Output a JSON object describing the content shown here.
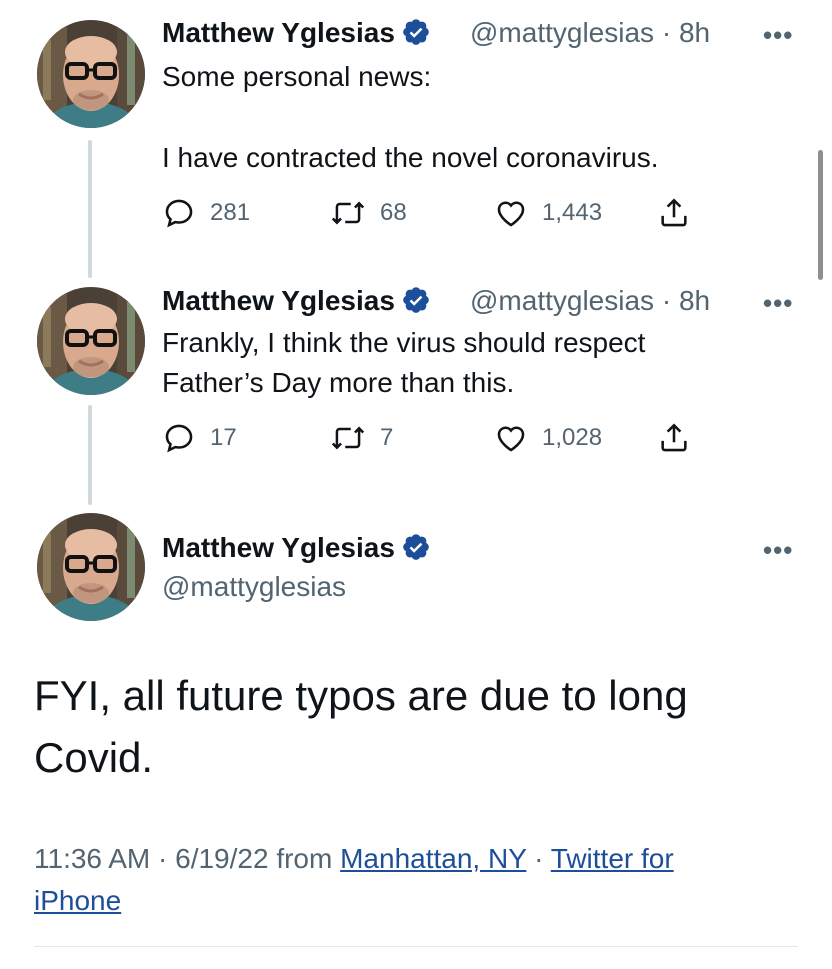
{
  "colors": {
    "verified": "#1d9bf0",
    "link": "#1d4e9a",
    "secondary_text": "#536471"
  },
  "tweets": [
    {
      "author_name": "Matthew Yglesias",
      "handle": "@mattyglesias",
      "separator": "·",
      "time": "8h",
      "more_label": "•••",
      "text_lines": [
        "Some personal news:",
        "",
        "I have contracted the novel coronavirus."
      ],
      "replies": "281",
      "retweets": "68",
      "likes": "1,443"
    },
    {
      "author_name": "Matthew Yglesias",
      "handle": "@mattyglesias",
      "separator": "·",
      "time": "8h",
      "more_label": "•••",
      "text_lines": [
        "Frankly, I think the virus should respect",
        "Father’s Day more than this."
      ],
      "replies": "17",
      "retweets": "7",
      "likes": "1,028"
    }
  ],
  "main_tweet": {
    "author_name": "Matthew Yglesias",
    "handle": "@mattyglesias",
    "more_label": "•••",
    "text_lines": [
      "FYI, all future typos are due to long",
      "Covid."
    ],
    "time": "11:36 AM",
    "separator": "·",
    "date": "6/19/22",
    "from_label": "from",
    "location": "Manhattan, NY",
    "separator2": "·",
    "source_line1": "Twitter for",
    "source_line2": "iPhone"
  },
  "icons": {
    "reply": "reply-icon",
    "retweet": "retweet-icon",
    "like": "heart-icon",
    "share": "share-icon",
    "verified": "verified-badge-icon",
    "more": "more-options-icon"
  }
}
